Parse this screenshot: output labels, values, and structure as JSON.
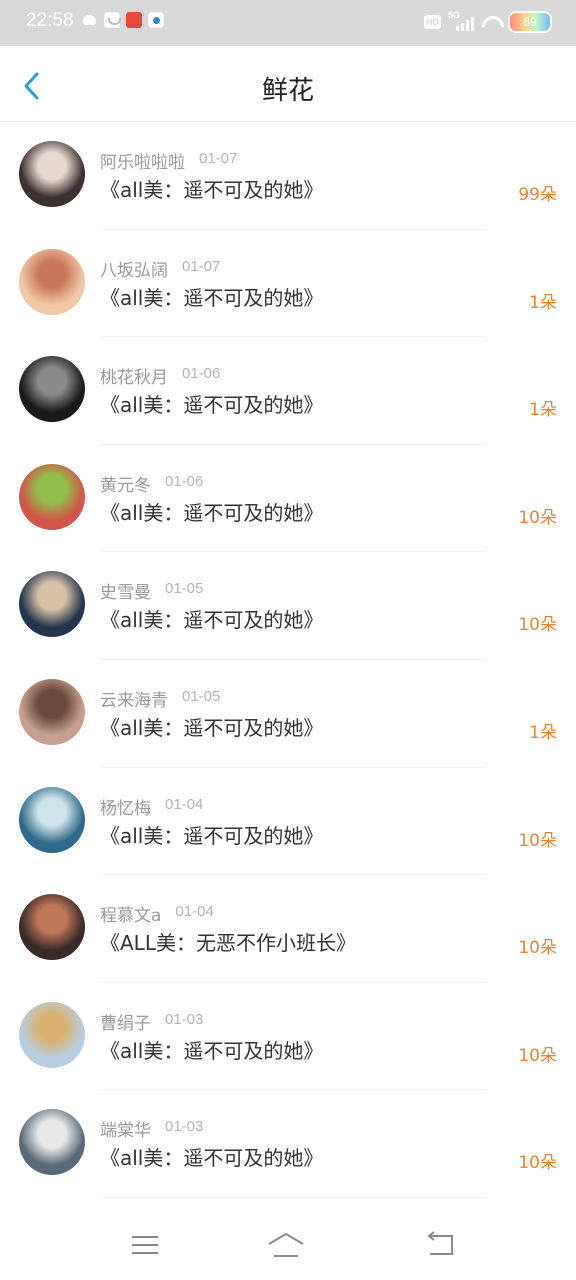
{
  "status_bar": {
    "time": "22:58",
    "hd_label": "HD",
    "network_label": "5G",
    "battery_level": "69"
  },
  "header": {
    "title": "鲜花"
  },
  "items": [
    {
      "name": "阿乐啦啦啦",
      "date": "01-07",
      "book": "《all美：遥不可及的她》",
      "count": "99朵",
      "avatar_colors": [
        "#3c3030",
        "#e8d8d0"
      ]
    },
    {
      "name": "八坂弘阔",
      "date": "01-07",
      "book": "《all美：遥不可及的她》",
      "count": "1朵",
      "avatar_colors": [
        "#f0c8a8",
        "#c87858"
      ]
    },
    {
      "name": "桃花秋月",
      "date": "01-06",
      "book": "《all美：遥不可及的她》",
      "count": "1朵",
      "avatar_colors": [
        "#1a1a1a",
        "#8a8a8a"
      ]
    },
    {
      "name": "黄元冬",
      "date": "01-06",
      "book": "《all美：遥不可及的她》",
      "count": "10朵",
      "avatar_colors": [
        "#d2554a",
        "#8fbf4a"
      ]
    },
    {
      "name": "史雪曼",
      "date": "01-05",
      "book": "《all美：遥不可及的她》",
      "count": "10朵",
      "avatar_colors": [
        "#23364e",
        "#d8c0a8"
      ]
    },
    {
      "name": "云来海青",
      "date": "01-05",
      "book": "《all美：遥不可及的她》",
      "count": "1朵",
      "avatar_colors": [
        "#c8a090",
        "#6a4a3a"
      ]
    },
    {
      "name": "杨忆梅",
      "date": "01-04",
      "book": "《all美：遥不可及的她》",
      "count": "10朵",
      "avatar_colors": [
        "#2f6a8a",
        "#cfe3ea"
      ]
    },
    {
      "name": "程慕文a",
      "date": "01-04",
      "book": "《ALL美：无恶不作小班长》",
      "count": "10朵",
      "avatar_colors": [
        "#3a2a28",
        "#c07858"
      ]
    },
    {
      "name": "曹绢子",
      "date": "01-03",
      "book": "《all美：遥不可及的她》",
      "count": "10朵",
      "avatar_colors": [
        "#b8cde0",
        "#d8b070"
      ]
    },
    {
      "name": "端棠华",
      "date": "01-03",
      "book": "《all美：遥不可及的她》",
      "count": "10朵",
      "avatar_colors": [
        "#5a6a78",
        "#e8e8e8"
      ]
    }
  ]
}
